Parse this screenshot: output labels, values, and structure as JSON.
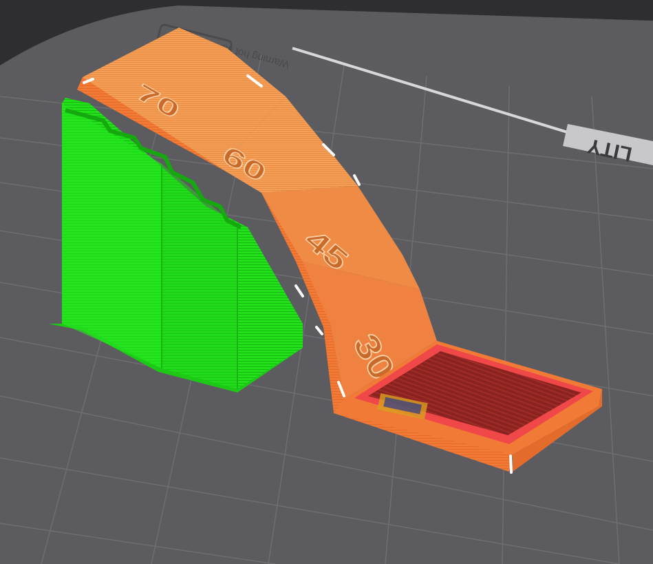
{
  "scene": {
    "bed_warning_text": "Warning hot surface",
    "bed_logo_text": "LITY",
    "angle_labels": [
      "70",
      "60",
      "45",
      "30"
    ]
  },
  "colors": {
    "background_dark": "#2e2e30",
    "bed_surface": "#5c5c60",
    "bed_grid": "#6e6e72",
    "support_material": "#22e01a",
    "model_wall": "#f07a36",
    "model_top": "#f29a55",
    "floor_fill": "#8a2220",
    "floor_border": "#f04848"
  }
}
